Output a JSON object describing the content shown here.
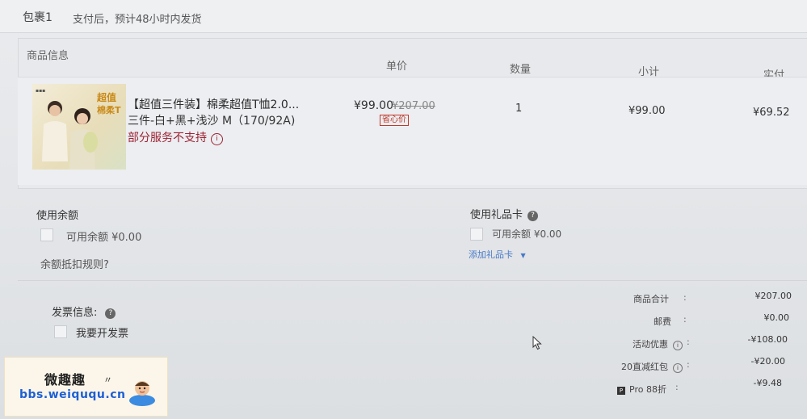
{
  "package": {
    "title": "包裹1",
    "note": "支付后，预计48小时内发货"
  },
  "table": {
    "headers": {
      "product_info": "商品信息",
      "unit_price": "单价",
      "quantity": "数量",
      "subtotal": "小计",
      "paid": "实付"
    },
    "item": {
      "thumb_badge_line1": "超值",
      "thumb_badge_line2": "棉柔T",
      "name": "【超值三件装】棉柔超值T恤2.0...",
      "sku": "三件-白+黑+浅沙 M（170/92A)",
      "service_note": "部分服务不支持",
      "price": "¥99.00",
      "original_price": "¥207.00",
      "price_tag": "省心价",
      "quantity": "1",
      "subtotal": "¥99.00",
      "paid": "¥69.52"
    }
  },
  "balance": {
    "title": "使用余额",
    "available": "可用余额 ¥0.00",
    "rules_link": "余额抵扣规则?"
  },
  "gift_card": {
    "title": "使用礼品卡",
    "available": "可用余额 ¥0.00",
    "add_link": "添加礼品卡"
  },
  "invoice": {
    "title": "发票信息:",
    "checkbox_label": "我要开发票"
  },
  "totals": [
    {
      "label": "商品合计",
      "value": "¥207.00"
    },
    {
      "label": "邮费",
      "value": "¥0.00"
    },
    {
      "label": "活动优惠",
      "value": "-¥108.00"
    },
    {
      "label": "20直减红包",
      "value": "-¥20.00"
    },
    {
      "label": "Pro 88折",
      "value": "-¥9.48"
    }
  ],
  "watermark": {
    "title": "微趣趣",
    "url": "bbs.weiququ.cn"
  },
  "colors": {
    "service_warning": "#9c2233",
    "price_tag": "#c0392b",
    "link": "#4a7ac8"
  }
}
